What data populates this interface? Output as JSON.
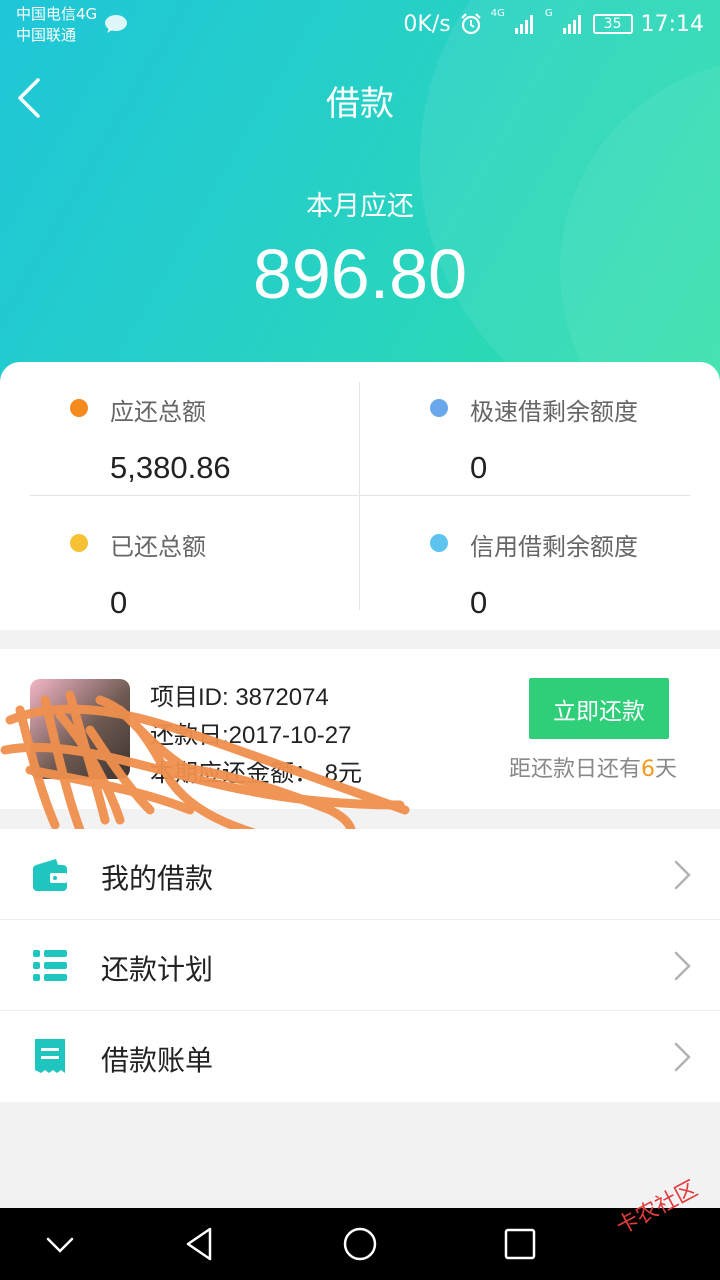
{
  "status_bar": {
    "carrier_1": "中国电信4G",
    "carrier_2": "中国联通",
    "speed": "0K/s",
    "network_1": "4G",
    "network_2": "G",
    "battery": "35",
    "time": "17:14"
  },
  "header": {
    "title": "借款",
    "due_label": "本月应还",
    "due_amount": "896.80"
  },
  "summary": {
    "items": [
      {
        "label": "应还总额",
        "value": "5,380.86",
        "dot_color": "#f58a1f"
      },
      {
        "label": "极速借剩余额度",
        "value": "0",
        "dot_color": "#6aa7ea"
      },
      {
        "label": "已还总额",
        "value": "0",
        "dot_color": "#f7c136"
      },
      {
        "label": "信用借剩余额度",
        "value": "0",
        "dot_color": "#5cc4ee"
      }
    ]
  },
  "loan": {
    "project_id": "项目ID: 3872074",
    "due_date": "还款日:2017-10-27",
    "amount_text": "本期应还金额：  8元",
    "repay_button": "立即还款",
    "countdown_prefix": "距还款日还有",
    "countdown_days": "6",
    "countdown_suffix": "天"
  },
  "menu": {
    "items": [
      {
        "label": "我的借款",
        "icon": "wallet-icon"
      },
      {
        "label": "还款计划",
        "icon": "list-icon"
      },
      {
        "label": "借款账单",
        "icon": "receipt-icon"
      }
    ]
  },
  "watermark": "卡农社区",
  "colors": {
    "header_start": "#1fc6d8",
    "header_end": "#2fe1a6",
    "accent_green": "#2fcf7a",
    "highlight_orange": "#f39a1e",
    "menu_icon": "#1fc6c0"
  }
}
